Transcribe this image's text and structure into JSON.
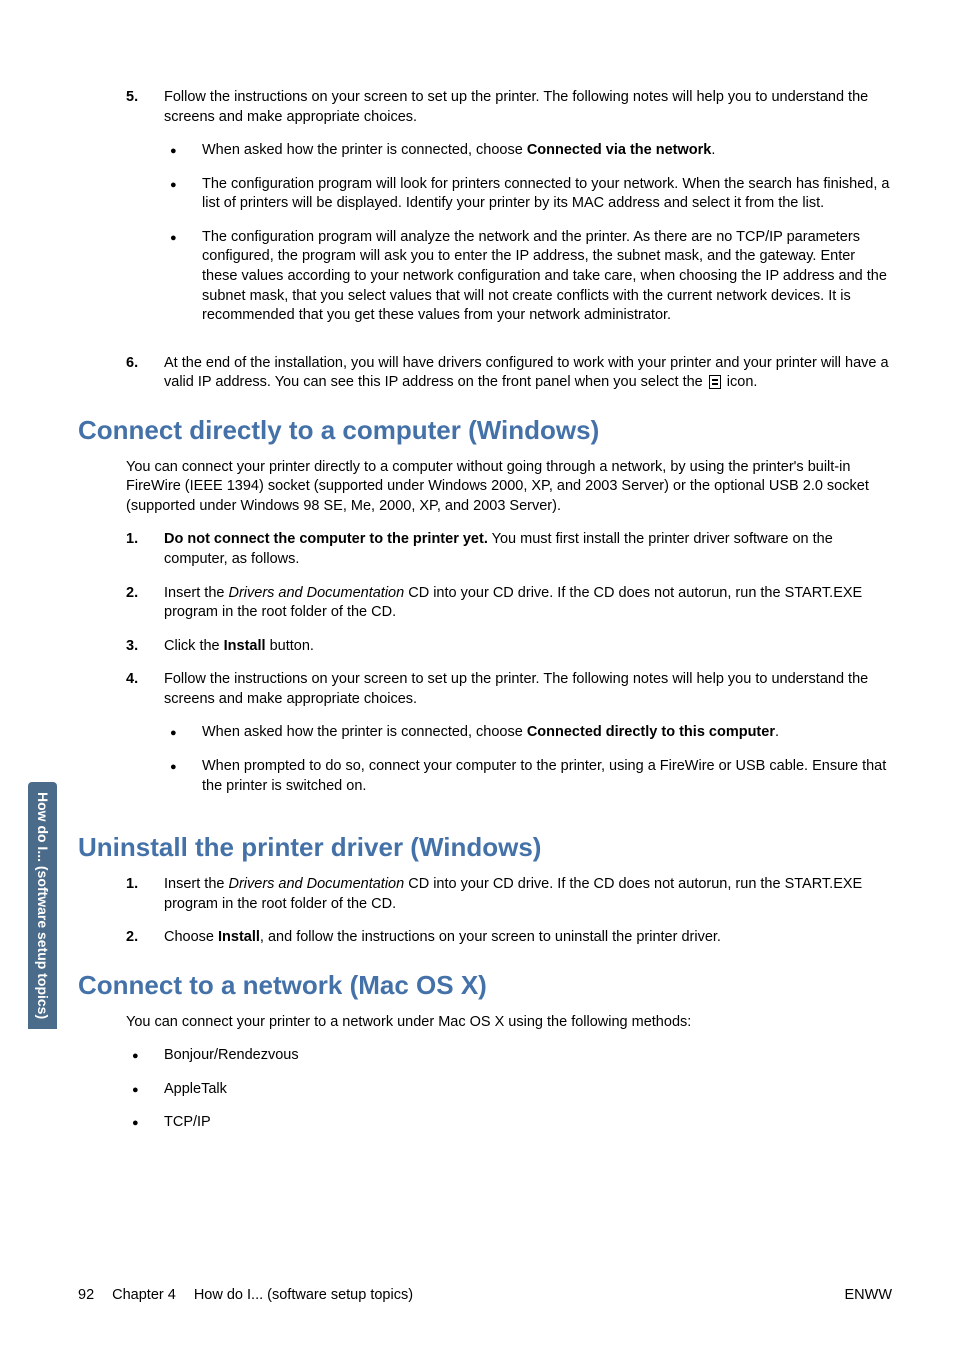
{
  "sidebar": {
    "label": "How do I... (software setup topics)"
  },
  "step5": {
    "num": "5.",
    "text_a": "Follow the instructions on your screen to set up the printer. The following notes will help you to understand the screens and make appropriate choices.",
    "bullets": [
      {
        "pre": "When asked how the printer is connected, choose ",
        "bold": "Connected via the network",
        "post": "."
      },
      {
        "text": "The configuration program will look for printers connected to your network. When the search has finished, a list of printers will be displayed. Identify your printer by its MAC address and select it from the list."
      },
      {
        "text": "The configuration program will analyze the network and the printer. As there are no TCP/IP parameters configured, the program will ask you to enter the IP address, the subnet mask, and the gateway. Enter these values according to your network configuration and take care, when choosing the IP address and the subnet mask, that you select values that will not create conflicts with the current network devices. It is recommended that you get these values from your network administrator."
      }
    ]
  },
  "step6": {
    "num": "6.",
    "text_a": "At the end of the installation, you will have drivers configured to work with your printer and your printer will have a valid IP address. You can see this IP address on the front panel when you select the ",
    "text_b": " icon."
  },
  "sec1": {
    "heading": "Connect directly to a computer (Windows)",
    "intro": "You can connect your printer directly to a computer without going through a network, by using the printer's built-in FireWire (IEEE 1394) socket (supported under Windows 2000, XP, and 2003 Server) or the optional USB 2.0 socket (supported under Windows 98 SE, Me, 2000, XP, and 2003 Server).",
    "steps": [
      {
        "num": "1.",
        "bold": "Do not connect the computer to the printer yet.",
        "post": " You must first install the printer driver software on the computer, as follows."
      },
      {
        "num": "2.",
        "pre": "Insert the ",
        "ital": "Drivers and Documentation",
        "post": " CD into your CD drive. If the CD does not autorun, run the START.EXE program in the root folder of the CD."
      },
      {
        "num": "3.",
        "pre": "Click the ",
        "bold2": "Install",
        "post2": " button."
      },
      {
        "num": "4.",
        "text": "Follow the instructions on your screen to set up the printer. The following notes will help you to understand the screens and make appropriate choices.",
        "bullets": [
          {
            "pre": "When asked how the printer is connected, choose ",
            "bold": "Connected directly to this computer",
            "post": "."
          },
          {
            "text": "When prompted to do so, connect your computer to the printer, using a FireWire or USB cable. Ensure that the printer is switched on."
          }
        ]
      }
    ]
  },
  "sec2": {
    "heading": "Uninstall the printer driver (Windows)",
    "steps": [
      {
        "num": "1.",
        "pre": "Insert the ",
        "ital": "Drivers and Documentation",
        "post": " CD into your CD drive. If the CD does not autorun, run the START.EXE program in the root folder of the CD."
      },
      {
        "num": "2.",
        "pre": "Choose ",
        "bold": "Install",
        "post": ", and follow the instructions on your screen to uninstall the printer driver."
      }
    ]
  },
  "sec3": {
    "heading": "Connect to a network (Mac OS X)",
    "intro": "You can connect your printer to a network under Mac OS X using the following methods:",
    "bullets": [
      {
        "text": "Bonjour/Rendezvous"
      },
      {
        "text": "AppleTalk"
      },
      {
        "text": "TCP/IP"
      }
    ]
  },
  "footer": {
    "page": "92",
    "chapter": "Chapter 4",
    "title": "How do I... (software setup topics)",
    "right": "ENWW"
  }
}
